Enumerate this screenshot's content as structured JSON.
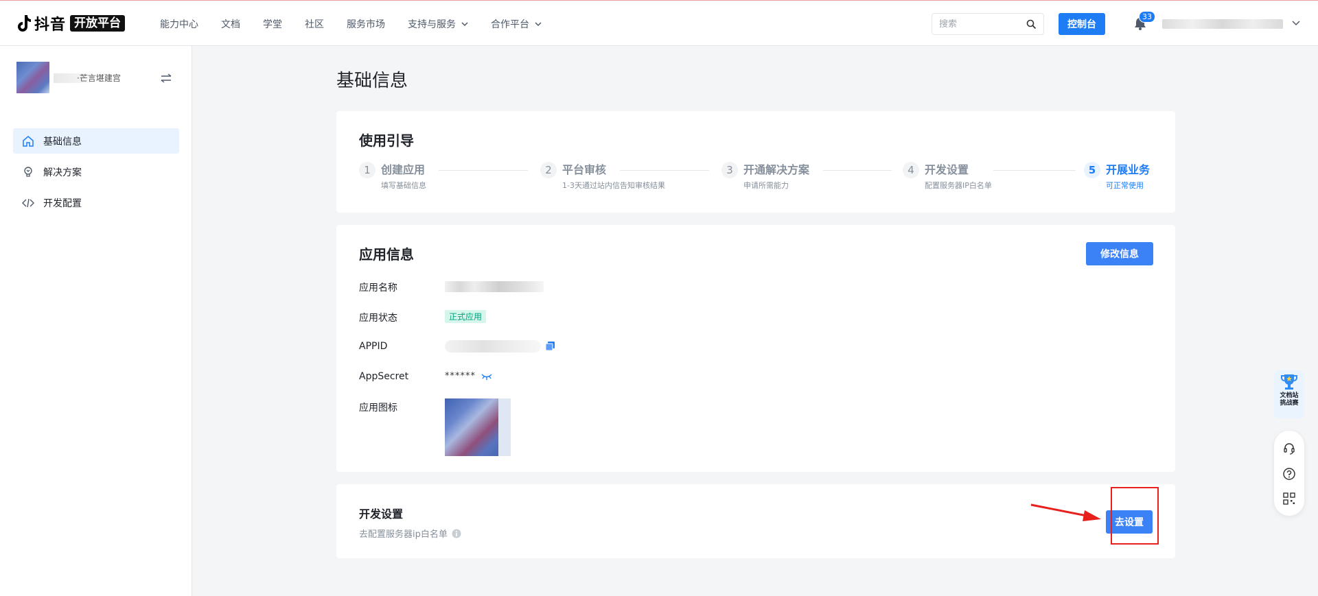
{
  "header": {
    "brand": "抖音",
    "brand_tag": "开放平台",
    "nav": [
      "能力中心",
      "文档",
      "学堂",
      "社区",
      "服务市场",
      "支持与服务",
      "合作平台"
    ],
    "search_placeholder": "搜索",
    "console_label": "控制台",
    "notification_count": "33"
  },
  "sidebar": {
    "app_name_partial": "·芒言堪建宫",
    "menu": [
      {
        "label": "基础信息",
        "icon": "home-icon"
      },
      {
        "label": "解决方案",
        "icon": "bulb-icon"
      },
      {
        "label": "开发配置",
        "icon": "code-icon"
      }
    ]
  },
  "page": {
    "title": "基础信息"
  },
  "guide": {
    "title": "使用引导",
    "steps": [
      {
        "num": "1",
        "title": "创建应用",
        "desc": "填写基础信息"
      },
      {
        "num": "2",
        "title": "平台审核",
        "desc": "1-3天通过站内信告知审核结果"
      },
      {
        "num": "3",
        "title": "开通解决方案",
        "desc": "申请所需能力"
      },
      {
        "num": "4",
        "title": "开发设置",
        "desc": "配置服务器IP白名单"
      },
      {
        "num": "5",
        "title": "开展业务",
        "desc": "可正常使用"
      }
    ]
  },
  "app_info": {
    "title": "应用信息",
    "edit_label": "修改信息",
    "name_label": "应用名称",
    "status_label": "应用状态",
    "status_value": "正式应用",
    "appid_label": "APPID",
    "secret_label": "AppSecret",
    "secret_value": "******",
    "icon_label": "应用图标"
  },
  "dev_settings": {
    "title": "开发设置",
    "desc": "去配置服务器ip白名单",
    "button_label": "去设置"
  },
  "float": {
    "trophy_line1": "文档站",
    "trophy_line2": "挑战赛"
  },
  "colors": {
    "primary": "#1e7df4",
    "button": "#3b82f6",
    "status_bg": "#d6f5ec",
    "status_text": "#00a37a",
    "highlight": "#e8201c"
  }
}
